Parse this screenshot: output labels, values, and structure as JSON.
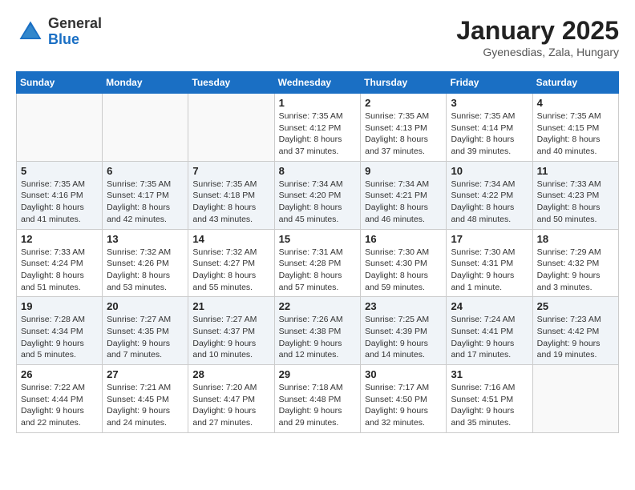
{
  "header": {
    "logo_general": "General",
    "logo_blue": "Blue",
    "month_title": "January 2025",
    "location": "Gyenesdias, Zala, Hungary"
  },
  "weekdays": [
    "Sunday",
    "Monday",
    "Tuesday",
    "Wednesday",
    "Thursday",
    "Friday",
    "Saturday"
  ],
  "weeks": [
    [
      {
        "day": "",
        "info": ""
      },
      {
        "day": "",
        "info": ""
      },
      {
        "day": "",
        "info": ""
      },
      {
        "day": "1",
        "info": "Sunrise: 7:35 AM\nSunset: 4:12 PM\nDaylight: 8 hours and 37 minutes."
      },
      {
        "day": "2",
        "info": "Sunrise: 7:35 AM\nSunset: 4:13 PM\nDaylight: 8 hours and 37 minutes."
      },
      {
        "day": "3",
        "info": "Sunrise: 7:35 AM\nSunset: 4:14 PM\nDaylight: 8 hours and 39 minutes."
      },
      {
        "day": "4",
        "info": "Sunrise: 7:35 AM\nSunset: 4:15 PM\nDaylight: 8 hours and 40 minutes."
      }
    ],
    [
      {
        "day": "5",
        "info": "Sunrise: 7:35 AM\nSunset: 4:16 PM\nDaylight: 8 hours and 41 minutes."
      },
      {
        "day": "6",
        "info": "Sunrise: 7:35 AM\nSunset: 4:17 PM\nDaylight: 8 hours and 42 minutes."
      },
      {
        "day": "7",
        "info": "Sunrise: 7:35 AM\nSunset: 4:18 PM\nDaylight: 8 hours and 43 minutes."
      },
      {
        "day": "8",
        "info": "Sunrise: 7:34 AM\nSunset: 4:20 PM\nDaylight: 8 hours and 45 minutes."
      },
      {
        "day": "9",
        "info": "Sunrise: 7:34 AM\nSunset: 4:21 PM\nDaylight: 8 hours and 46 minutes."
      },
      {
        "day": "10",
        "info": "Sunrise: 7:34 AM\nSunset: 4:22 PM\nDaylight: 8 hours and 48 minutes."
      },
      {
        "day": "11",
        "info": "Sunrise: 7:33 AM\nSunset: 4:23 PM\nDaylight: 8 hours and 50 minutes."
      }
    ],
    [
      {
        "day": "12",
        "info": "Sunrise: 7:33 AM\nSunset: 4:24 PM\nDaylight: 8 hours and 51 minutes."
      },
      {
        "day": "13",
        "info": "Sunrise: 7:32 AM\nSunset: 4:26 PM\nDaylight: 8 hours and 53 minutes."
      },
      {
        "day": "14",
        "info": "Sunrise: 7:32 AM\nSunset: 4:27 PM\nDaylight: 8 hours and 55 minutes."
      },
      {
        "day": "15",
        "info": "Sunrise: 7:31 AM\nSunset: 4:28 PM\nDaylight: 8 hours and 57 minutes."
      },
      {
        "day": "16",
        "info": "Sunrise: 7:30 AM\nSunset: 4:30 PM\nDaylight: 8 hours and 59 minutes."
      },
      {
        "day": "17",
        "info": "Sunrise: 7:30 AM\nSunset: 4:31 PM\nDaylight: 9 hours and 1 minute."
      },
      {
        "day": "18",
        "info": "Sunrise: 7:29 AM\nSunset: 4:32 PM\nDaylight: 9 hours and 3 minutes."
      }
    ],
    [
      {
        "day": "19",
        "info": "Sunrise: 7:28 AM\nSunset: 4:34 PM\nDaylight: 9 hours and 5 minutes."
      },
      {
        "day": "20",
        "info": "Sunrise: 7:27 AM\nSunset: 4:35 PM\nDaylight: 9 hours and 7 minutes."
      },
      {
        "day": "21",
        "info": "Sunrise: 7:27 AM\nSunset: 4:37 PM\nDaylight: 9 hours and 10 minutes."
      },
      {
        "day": "22",
        "info": "Sunrise: 7:26 AM\nSunset: 4:38 PM\nDaylight: 9 hours and 12 minutes."
      },
      {
        "day": "23",
        "info": "Sunrise: 7:25 AM\nSunset: 4:39 PM\nDaylight: 9 hours and 14 minutes."
      },
      {
        "day": "24",
        "info": "Sunrise: 7:24 AM\nSunset: 4:41 PM\nDaylight: 9 hours and 17 minutes."
      },
      {
        "day": "25",
        "info": "Sunrise: 7:23 AM\nSunset: 4:42 PM\nDaylight: 9 hours and 19 minutes."
      }
    ],
    [
      {
        "day": "26",
        "info": "Sunrise: 7:22 AM\nSunset: 4:44 PM\nDaylight: 9 hours and 22 minutes."
      },
      {
        "day": "27",
        "info": "Sunrise: 7:21 AM\nSunset: 4:45 PM\nDaylight: 9 hours and 24 minutes."
      },
      {
        "day": "28",
        "info": "Sunrise: 7:20 AM\nSunset: 4:47 PM\nDaylight: 9 hours and 27 minutes."
      },
      {
        "day": "29",
        "info": "Sunrise: 7:18 AM\nSunset: 4:48 PM\nDaylight: 9 hours and 29 minutes."
      },
      {
        "day": "30",
        "info": "Sunrise: 7:17 AM\nSunset: 4:50 PM\nDaylight: 9 hours and 32 minutes."
      },
      {
        "day": "31",
        "info": "Sunrise: 7:16 AM\nSunset: 4:51 PM\nDaylight: 9 hours and 35 minutes."
      },
      {
        "day": "",
        "info": ""
      }
    ]
  ]
}
